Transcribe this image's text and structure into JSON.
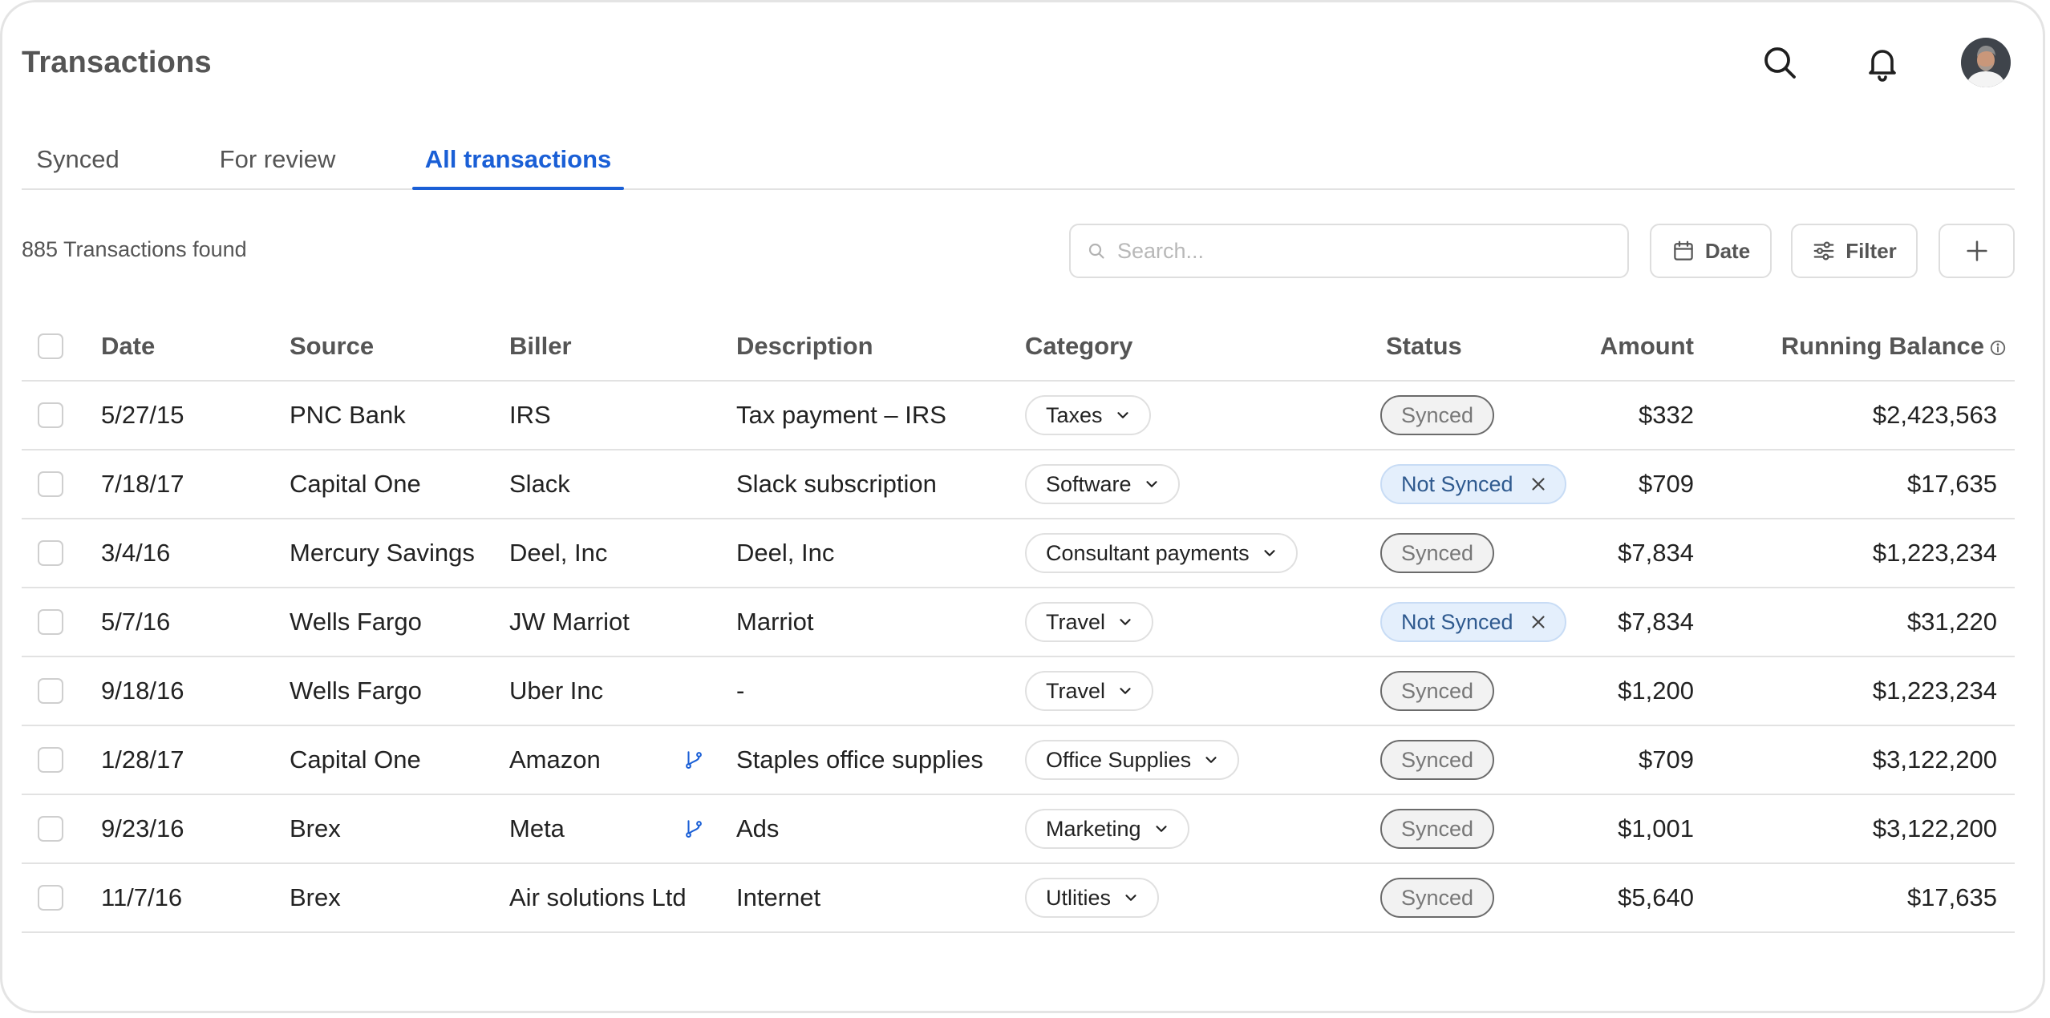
{
  "header": {
    "title": "Transactions",
    "avatar_alt": "User avatar"
  },
  "tabs": [
    {
      "label": "Synced",
      "active": false
    },
    {
      "label": "For review",
      "active": false
    },
    {
      "label": "All transactions",
      "active": true
    }
  ],
  "toolbar": {
    "found_text": "885 Transactions found",
    "search_placeholder": "Search...",
    "date_label": "Date",
    "filter_label": "Filter"
  },
  "table": {
    "columns": {
      "date": "Date",
      "source": "Source",
      "biller": "Biller",
      "description": "Description",
      "category": "Category",
      "status": "Status",
      "amount": "Amount",
      "balance": "Running Balance"
    },
    "rows": [
      {
        "date": "5/27/15",
        "source": "PNC Bank",
        "biller": "IRS",
        "split": false,
        "description": "Tax payment – IRS",
        "category": "Taxes",
        "status": "Synced",
        "amount": "$332",
        "balance": "$2,423,563"
      },
      {
        "date": "7/18/17",
        "source": "Capital One",
        "biller": "Slack",
        "split": false,
        "description": "Slack subscription",
        "category": "Software",
        "status": "Not Synced",
        "amount": "$709",
        "balance": "$17,635"
      },
      {
        "date": "3/4/16",
        "source": "Mercury Savings",
        "biller": "Deel, Inc",
        "split": false,
        "description": "Deel, Inc",
        "category": "Consultant payments",
        "status": "Synced",
        "amount": "$7,834",
        "balance": "$1,223,234"
      },
      {
        "date": "5/7/16",
        "source": "Wells Fargo",
        "biller": "JW Marriot",
        "split": false,
        "description": "Marriot",
        "category": "Travel",
        "status": "Not Synced",
        "amount": "$7,834",
        "balance": "$31,220"
      },
      {
        "date": "9/18/16",
        "source": "Wells Fargo",
        "biller": "Uber Inc",
        "split": false,
        "description": "-",
        "category": "Travel",
        "status": "Synced",
        "amount": "$1,200",
        "balance": "$1,223,234"
      },
      {
        "date": "1/28/17",
        "source": "Capital One",
        "biller": "Amazon",
        "split": true,
        "description": "Staples office supplies",
        "category": "Office Supplies",
        "status": "Synced",
        "amount": "$709",
        "balance": "$3,122,200"
      },
      {
        "date": "9/23/16",
        "source": "Brex",
        "biller": "Meta",
        "split": true,
        "description": "Ads",
        "category": "Marketing",
        "status": "Synced",
        "amount": "$1,001",
        "balance": "$3,122,200"
      },
      {
        "date": "11/7/16",
        "source": "Brex",
        "biller": "Air solutions Ltd",
        "split": false,
        "description": "Internet",
        "category": "Utlities",
        "status": "Synced",
        "amount": "$5,640",
        "balance": "$17,635"
      }
    ]
  },
  "colors": {
    "accent": "#1a5fd6",
    "not_synced_bg": "#e4effc",
    "not_synced_text": "#2f5a8f",
    "synced_border": "#6b6b6b"
  },
  "icons": {
    "search": "search-icon",
    "notifications": "bell-icon",
    "date": "calendar-icon",
    "filter": "sliders-icon",
    "add": "plus-icon",
    "category_dropdown": "chevron-down-icon",
    "remove_status": "close-icon",
    "split": "git-branch-icon",
    "info": "info-icon"
  }
}
